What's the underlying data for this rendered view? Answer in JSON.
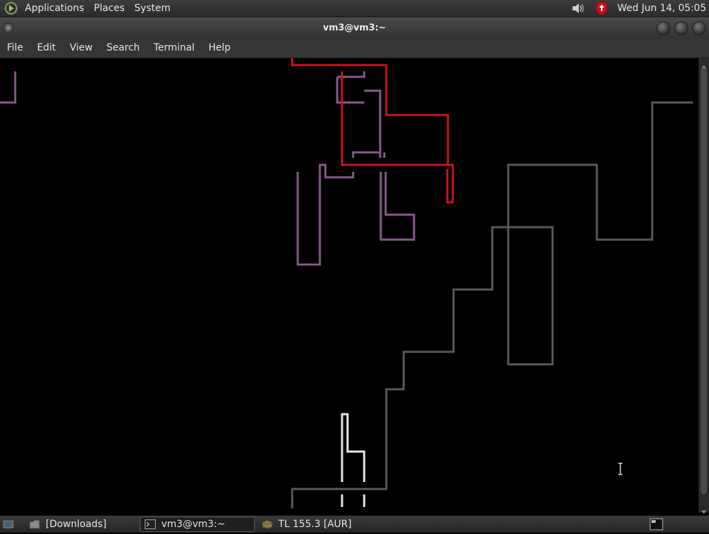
{
  "top_panel": {
    "menus": [
      "Applications",
      "Places",
      "System"
    ],
    "clock": "Wed Jun 14, 05:05",
    "icons": [
      "distro-logo-icon",
      "volume-icon",
      "security-shield-icon"
    ]
  },
  "window": {
    "title": "vm3@vm3:~",
    "menubar": [
      "File",
      "Edit",
      "View",
      "Search",
      "Terminal",
      "Help"
    ]
  },
  "terminal": {
    "content": "line-drawing screensaver (pipes)",
    "colors": {
      "background": "#000000",
      "red": "#c8141e",
      "purple": "#8a5a8e",
      "gray": "#5a5a5a",
      "white": "#e8e8e8"
    }
  },
  "taskbar": {
    "tasks": [
      {
        "label": "[Downloads]",
        "icon": "folder-icon",
        "active": false
      },
      {
        "label": "vm3@vm3:~",
        "icon": "terminal-icon",
        "active": true
      },
      {
        "label": "TL 155.3 [AUR]",
        "icon": "package-icon",
        "active": false
      }
    ]
  }
}
